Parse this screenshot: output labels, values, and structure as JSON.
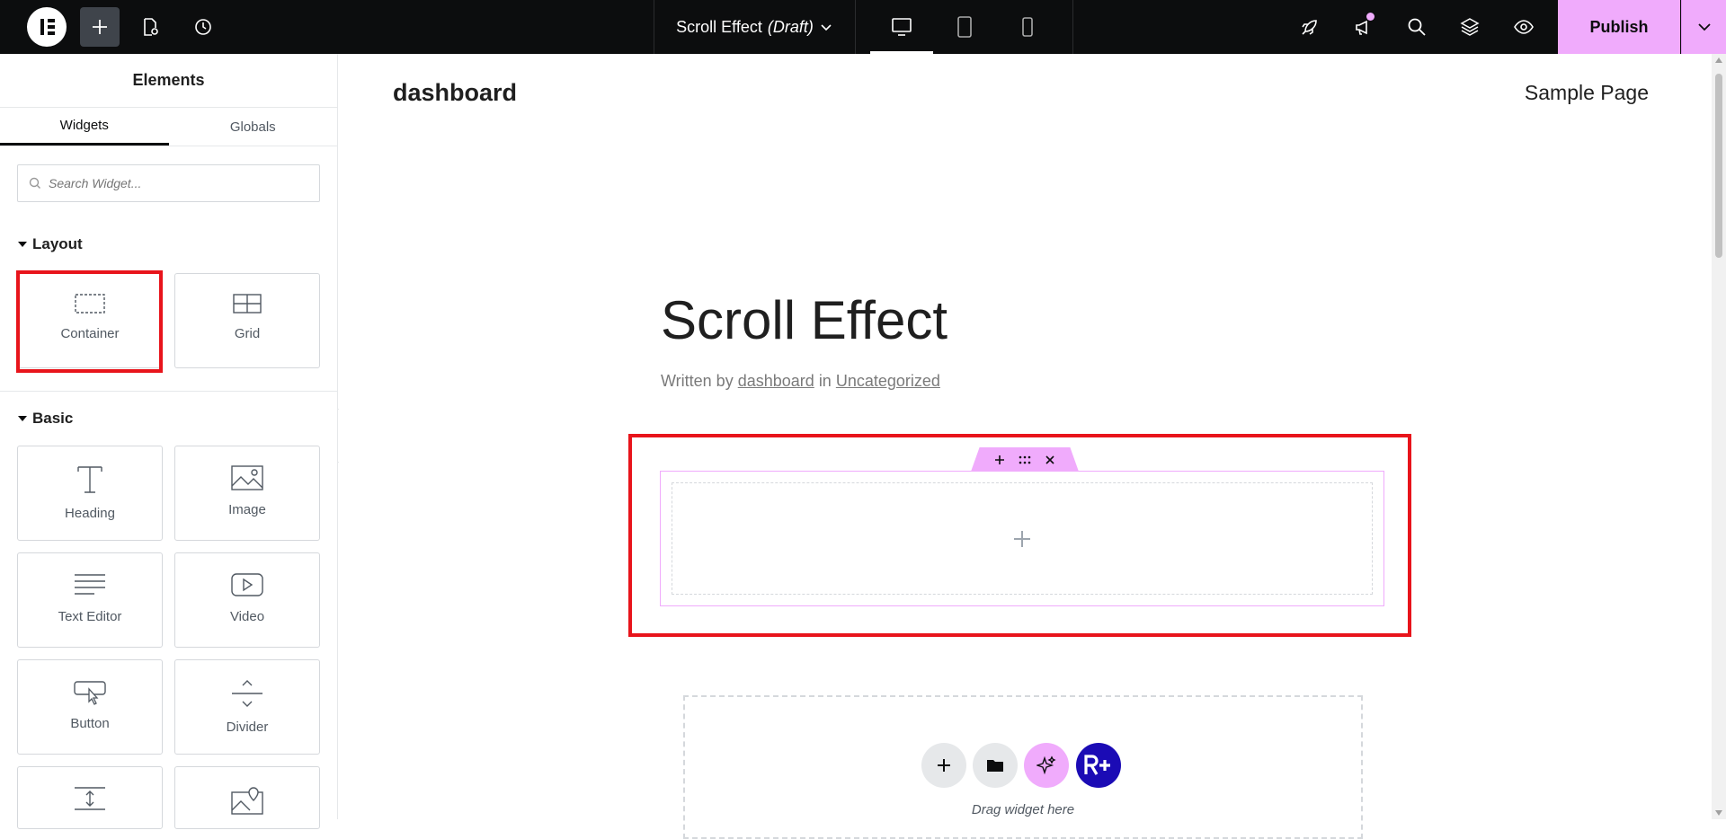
{
  "topbar": {
    "doc_title": "Scroll Effect",
    "doc_status": "(Draft)",
    "publish_label": "Publish",
    "accent_color": "#f0abfc",
    "active_device": "desktop"
  },
  "panel": {
    "title": "Elements",
    "tabs": [
      {
        "label": "Widgets",
        "active": true
      },
      {
        "label": "Globals",
        "active": false
      }
    ],
    "search_placeholder": "Search Widget...",
    "sections": [
      {
        "title": "Layout"
      },
      {
        "title": "Basic"
      }
    ],
    "widgets": {
      "container": "Container",
      "grid": "Grid",
      "heading": "Heading",
      "image": "Image",
      "text_editor": "Text Editor",
      "video": "Video",
      "button": "Button",
      "divider": "Divider"
    }
  },
  "canvas": {
    "site_title": "dashboard",
    "nav_link": "Sample Page",
    "post_title": "Scroll Effect",
    "meta_prefix": "Written by",
    "meta_author": "dashboard",
    "meta_in": "in",
    "meta_category": "Uncategorized",
    "drop_hint": "Drag widget here"
  }
}
